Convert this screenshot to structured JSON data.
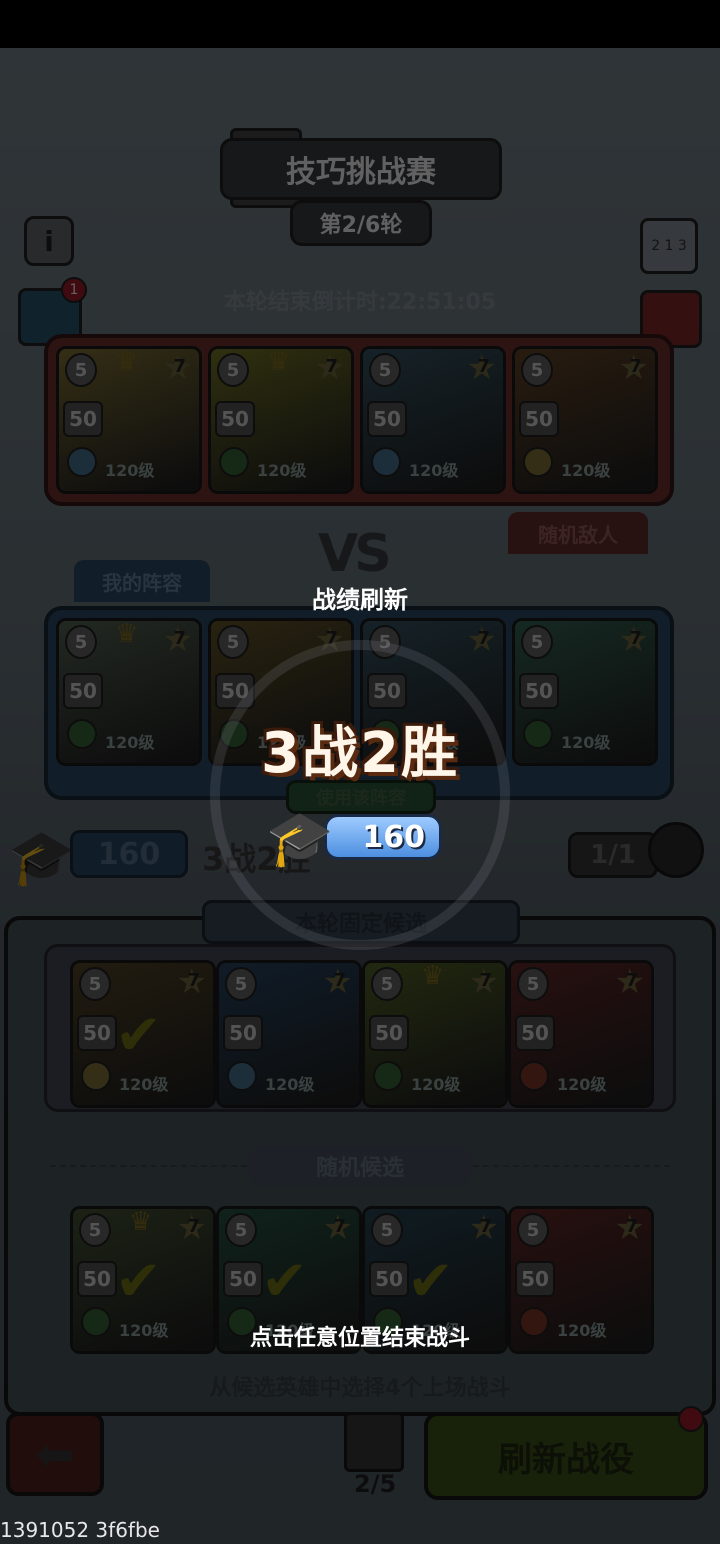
{
  "header": {
    "title": "技巧挑战赛",
    "round": "第2/6轮",
    "countdown": "本轮结束倒计时:22:51:05",
    "book_badge": "1",
    "rank_icon_text": "2 1 3"
  },
  "enemy": {
    "tab": "随机敌人",
    "cards": [
      {
        "tag": "5",
        "star": "7",
        "level_a": "50",
        "level": "120级",
        "color": "#8a7a3a",
        "elem": "#4a7a9a",
        "crown": true
      },
      {
        "tag": "5",
        "star": "7",
        "level_a": "50",
        "level": "120级",
        "color": "#7d7d2a",
        "elem": "#3a6a3a",
        "crown": true
      },
      {
        "tag": "5",
        "star": "7",
        "level_a": "50",
        "level": "120级",
        "color": "#3a5a6a",
        "elem": "#4a7a9a",
        "crown": false
      },
      {
        "tag": "5",
        "star": "7",
        "level_a": "50",
        "level": "120级",
        "color": "#6a4a2a",
        "elem": "#8a7a3a",
        "crown": false
      }
    ]
  },
  "vs": "VS",
  "mine": {
    "tab": "我的阵容",
    "button_behind": "使用该阵容",
    "cards": [
      {
        "tag": "5",
        "star": "7",
        "level_a": "50",
        "level": "120级",
        "color": "#5a6a5a",
        "elem": "#3a6a3a",
        "crown": true
      },
      {
        "tag": "5",
        "star": "7",
        "level_a": "50",
        "level": "120级",
        "color": "#6a5a2a",
        "elem": "#3a6a3a",
        "crown": false
      },
      {
        "tag": "5",
        "star": "7",
        "level_a": "50",
        "level": "120级",
        "color": "#3a5a6a",
        "elem": "#3a6a3a",
        "crown": false
      },
      {
        "tag": "5",
        "star": "7",
        "level_a": "50",
        "level": "120级",
        "color": "#3a6a5a",
        "elem": "#3a6a3a",
        "crown": false
      }
    ]
  },
  "status": {
    "points": "160",
    "record_behind": "3战2胜",
    "attempts": "1/1"
  },
  "fixed": {
    "label": "本轮固定候选",
    "cards": [
      {
        "tag": "5",
        "star": "7",
        "level_a": "50",
        "level": "120级",
        "color": "#5a4a2a",
        "elem": "#8a7a3a",
        "check": true
      },
      {
        "tag": "5",
        "star": "7",
        "level_a": "50",
        "level": "120级",
        "color": "#2a4a6a",
        "elem": "#4a7a9a",
        "check": false
      },
      {
        "tag": "5",
        "star": "7",
        "level_a": "50",
        "level": "120级",
        "color": "#5a6a2a",
        "elem": "#3a6a3a",
        "check": false,
        "crown": true
      },
      {
        "tag": "5",
        "star": "7",
        "level_a": "50",
        "level": "120级",
        "color": "#6a2a2a",
        "elem": "#8a3a2a",
        "check": false
      }
    ]
  },
  "random": {
    "label": "随机候选",
    "cards": [
      {
        "tag": "5",
        "star": "7",
        "level_a": "50",
        "level": "120级",
        "color": "#4a5a3a",
        "elem": "#3a6a3a",
        "check": true,
        "crown": true
      },
      {
        "tag": "5",
        "star": "7",
        "level_a": "50",
        "level": "120级",
        "color": "#2a5a4a",
        "elem": "#3a6a3a",
        "check": true
      },
      {
        "tag": "5",
        "star": "7",
        "level_a": "50",
        "level": "120级",
        "color": "#2a4a5a",
        "elem": "#3a6a3a",
        "check": true
      },
      {
        "tag": "5",
        "star": "7",
        "level_a": "50",
        "level": "120级",
        "color": "#6a2a2a",
        "elem": "#8a3a2a",
        "check": false
      }
    ],
    "hint": "从候选英雄中选择4个上场战斗"
  },
  "bottom": {
    "back_icon": "arrow-left-icon",
    "battle_count": "2/5",
    "refresh": "刷新战役"
  },
  "overlay": {
    "title": "战绩刷新",
    "record": "3战2胜",
    "score": "160",
    "tap_hint": "点击任意位置结束战斗"
  },
  "footer_id": "1391052 3f6fbe"
}
